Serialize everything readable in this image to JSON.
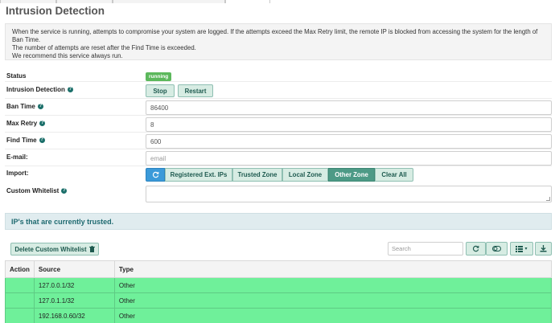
{
  "page": {
    "title": "Intrusion Detection",
    "description": [
      "When the service is running, attempts to compromise your system are logged. If the attempts exceed the Max Retry limit, the remote IP is blocked from accessing the system for the length of Ban Time.",
      "The number of attempts are reset after the Find Time is exceeded.",
      "We recommend this service always run."
    ]
  },
  "form": {
    "status_label": "Status",
    "status_value": "running",
    "service_label": "Intrusion Detection",
    "stop_label": "Stop",
    "restart_label": "Restart",
    "ban_time_label": "Ban Time",
    "ban_time_value": "86400",
    "max_retry_label": "Max Retry",
    "max_retry_value": "8",
    "find_time_label": "Find Time",
    "find_time_value": "600",
    "email_label": "E-mail:",
    "email_placeholder": "email",
    "import_label": "Import:",
    "import_options": [
      "Registered Ext. IPs",
      "Trusted Zone",
      "Local Zone",
      "Other Zone",
      "Clear All"
    ],
    "import_active": "Other Zone",
    "whitelist_label": "Custom Whitelist"
  },
  "trusted": {
    "header": "IP's that are currently trusted.",
    "delete_button": "Delete Custom Whitelist",
    "search_placeholder": "Search",
    "columns": [
      "Action",
      "Source",
      "Type"
    ],
    "rows": [
      {
        "action": "",
        "source": "127.0.0.1/32",
        "type": "Other"
      },
      {
        "action": "",
        "source": "127.0.1.1/32",
        "type": "Other"
      },
      {
        "action": "",
        "source": "192.168.0.60/32",
        "type": "Other"
      }
    ]
  },
  "icons": {
    "help": "question-icon",
    "refresh": "refresh-icon",
    "toggle": "toggle-icon",
    "columns": "list-icon",
    "export": "download-icon",
    "trash": "trash-icon"
  },
  "colors": {
    "accent": "#1e5a4f",
    "status_running": "#5cb85c",
    "row_highlight": "#6ff09a",
    "header_bg": "#e0ecef"
  }
}
